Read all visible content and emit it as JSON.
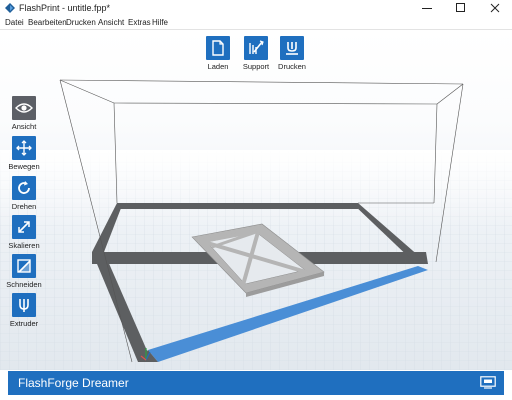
{
  "window": {
    "title": "FlashPrint - untitle.fpp*"
  },
  "menu": [
    "Datei",
    "Bearbeiten",
    "Drucken",
    "Ansicht",
    "Extras",
    "Hilfe"
  ],
  "top_toolbar": [
    {
      "label": "Laden",
      "icon": "file-open-icon"
    },
    {
      "label": "Support",
      "icon": "support-icon"
    },
    {
      "label": "Drucken",
      "icon": "print-icon"
    }
  ],
  "left_toolbar": [
    {
      "label": "Ansicht",
      "icon": "eye-icon",
      "selected": true
    },
    {
      "label": "Bewegen",
      "icon": "move-icon"
    },
    {
      "label": "Drehen",
      "icon": "rotate-icon"
    },
    {
      "label": "Skalieren",
      "icon": "scale-icon"
    },
    {
      "label": "Schneiden",
      "icon": "cut-icon"
    },
    {
      "label": "Extruder",
      "icon": "extruder-icon"
    }
  ],
  "status": {
    "printer": "FlashForge Dreamer",
    "icon": "connect-printer-icon"
  },
  "colors": {
    "accent": "#1f6fbf",
    "selected_tool": "#5c5f66",
    "model": "#b5b5b5",
    "grid": "#d2dbe3"
  }
}
